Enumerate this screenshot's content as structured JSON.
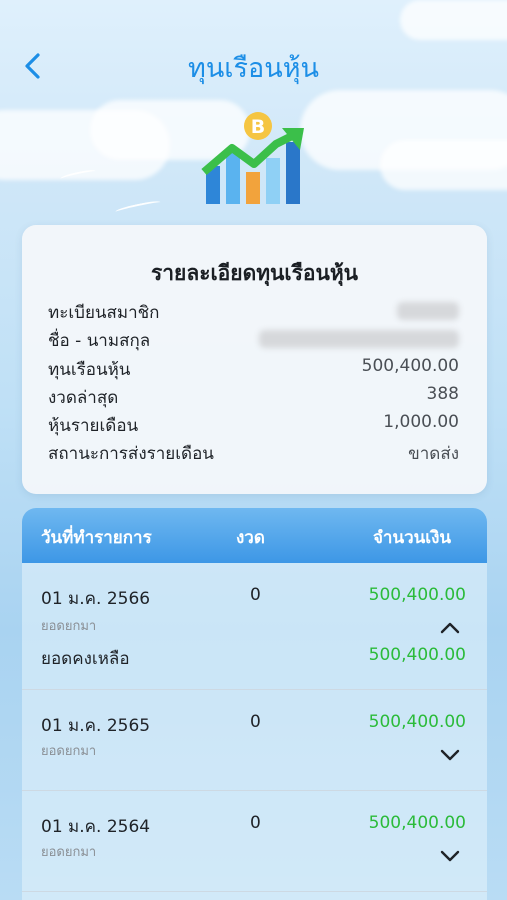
{
  "header": {
    "title": "ทุนเรือนหุ้น"
  },
  "details": {
    "title": "รายละเอียดทุนเรือนหุ้น",
    "rows": [
      {
        "label": "ทะเบียนสมาชิก",
        "value": ""
      },
      {
        "label": "ชื่อ - นามสกุล",
        "value": ""
      },
      {
        "label": "ทุนเรือนหุ้น",
        "value": "500,400.00"
      },
      {
        "label": "งวดล่าสุด",
        "value": "388"
      },
      {
        "label": "หุ้นรายเดือน",
        "value": "1,000.00"
      },
      {
        "label": "สถานะการส่งรายเดือน",
        "value": "ขาดส่ง"
      }
    ]
  },
  "table": {
    "columns": [
      "วันที่ทำรายการ",
      "งวด",
      "จำนวนเงิน"
    ],
    "rows": [
      {
        "date": "01 ม.ค. 2566",
        "desc": "ยอดยกมา",
        "period": "0",
        "amount": "500,400.00",
        "expanded": true,
        "balance_label": "ยอดคงเหลือ",
        "balance": "500,400.00"
      },
      {
        "date": "01 ม.ค. 2565",
        "desc": "ยอดยกมา",
        "period": "0",
        "amount": "500,400.00",
        "expanded": false
      },
      {
        "date": "01 ม.ค. 2564",
        "desc": "ยอดยกมา",
        "period": "0",
        "amount": "500,400.00",
        "expanded": false
      }
    ]
  },
  "colors": {
    "accent": "#1c8ee6",
    "amount_green": "#2bbb3a",
    "table_header": "#3d97e6"
  },
  "icons": {
    "back": "chevron-left-icon",
    "hero": "stock-chart-icon",
    "expand": "chevron-down-icon",
    "collapse": "chevron-up-icon"
  }
}
